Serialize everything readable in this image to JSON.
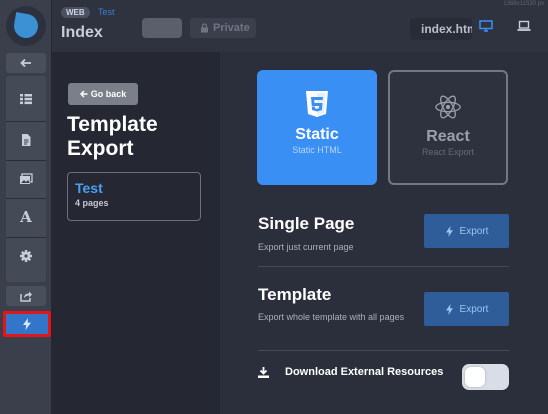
{
  "topbar": {
    "badge": "WEB",
    "project": "Test",
    "title": "Index",
    "private_label": "Private",
    "file_name": "index.html",
    "resolution": "1368x11530 px",
    "devices": [
      "desktop-icon",
      "laptop-icon"
    ]
  },
  "rail": {
    "items": [
      "back-icon",
      "grid-icon",
      "page-icon",
      "image-icon",
      "font-icon",
      "gear-icon",
      "share-icon",
      "bolt-icon"
    ],
    "font_letter": "A",
    "highlight_color": "#e0161a"
  },
  "panel": {
    "go_back": "Go back",
    "title": "Template Export",
    "template": {
      "name": "Test",
      "pages": "4 pages"
    }
  },
  "export_types": [
    {
      "name": "Static",
      "sub": "Static HTML",
      "icon": "html5-icon",
      "selected": true
    },
    {
      "name": "React",
      "sub": "React Export",
      "icon": "react-icon",
      "selected": false
    }
  ],
  "sections": {
    "single": {
      "title": "Single Page",
      "desc": "Export just current page",
      "button": "Export"
    },
    "template": {
      "title": "Template",
      "desc": "Export whole template with all pages",
      "button": "Export"
    }
  },
  "download": {
    "label": "Download External Resources",
    "enabled": false
  },
  "colors": {
    "accent": "#3a8ff5",
    "export_button": "#2e5d99",
    "project_link": "#3e7fd1"
  }
}
